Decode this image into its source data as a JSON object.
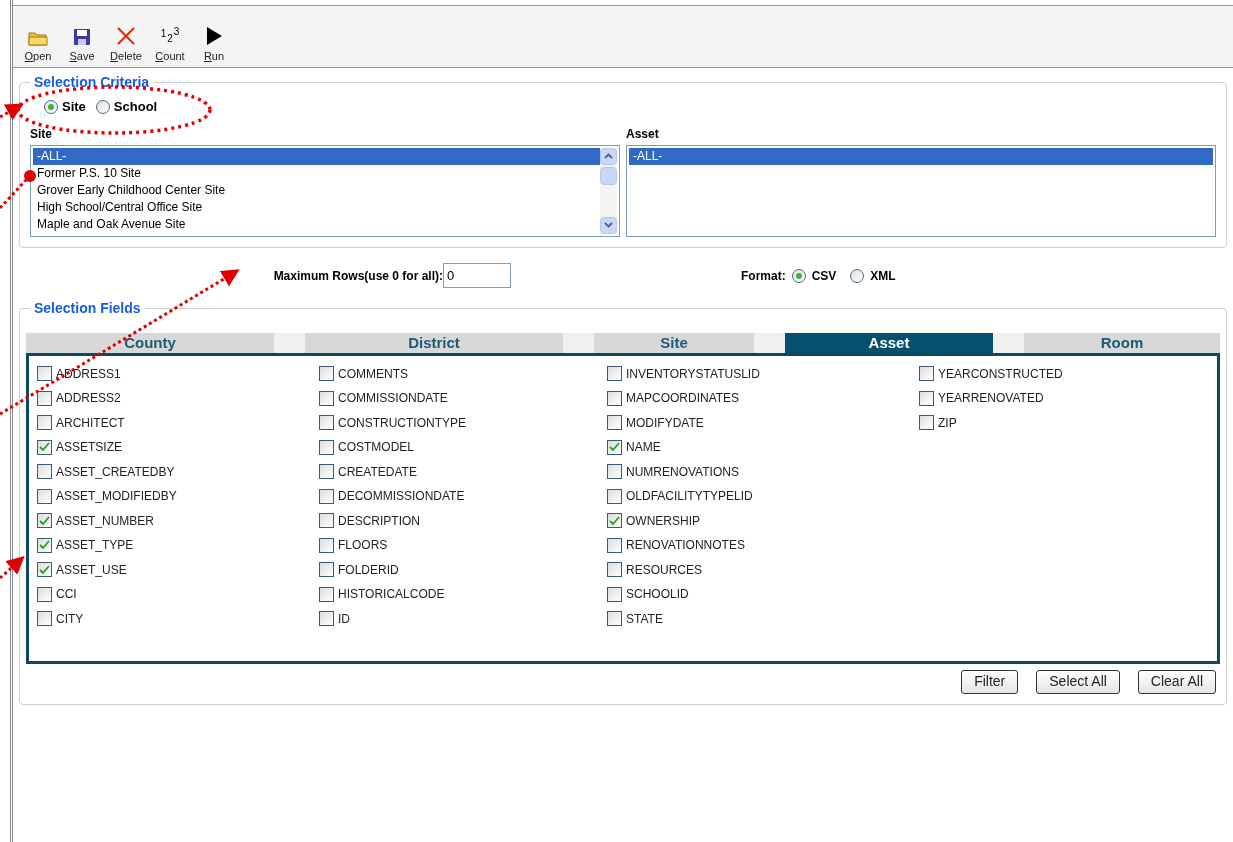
{
  "toolbar": [
    {
      "label": "Open"
    },
    {
      "label": "Save"
    },
    {
      "label": "Delete"
    },
    {
      "label": "Count",
      "glyph": [
        "1",
        "2",
        "3"
      ]
    },
    {
      "label": "Run"
    }
  ],
  "criteria": {
    "title": "Selection Criteria",
    "mode": [
      {
        "label": "Site",
        "selected": true
      },
      {
        "label": "School",
        "selected": false
      }
    ],
    "site_list": {
      "label": "Site",
      "items": [
        {
          "text": "-ALL-",
          "selected": true
        },
        {
          "text": "Former P.S. 10 Site",
          "selected": false
        },
        {
          "text": "Grover Early Childhood Center Site",
          "selected": false
        },
        {
          "text": "High School/Central Office Site",
          "selected": false
        },
        {
          "text": "Maple and Oak Avenue Site",
          "selected": false
        }
      ]
    },
    "asset_list": {
      "label": "Asset",
      "items": [
        {
          "text": "-ALL-",
          "selected": true
        }
      ]
    }
  },
  "max_rows": {
    "label": "Maximum Rows(use 0 for all):",
    "value": "0"
  },
  "format": {
    "label": "Format:",
    "options": [
      {
        "label": "CSV",
        "selected": true
      },
      {
        "label": "XML",
        "selected": false
      }
    ]
  },
  "fields": {
    "title": "Selection Fields",
    "tabs": [
      {
        "label": "County",
        "selected": false
      },
      {
        "label": "District",
        "selected": false
      },
      {
        "label": "Site",
        "selected": false
      },
      {
        "label": "Asset",
        "selected": true
      },
      {
        "label": "Room",
        "selected": false
      }
    ],
    "columns": [
      [
        {
          "label": "ADDRESS1",
          "checked": false
        },
        {
          "label": "ADDRESS2",
          "checked": false
        },
        {
          "label": "ARCHITECT",
          "checked": false
        },
        {
          "label": "ASSETSIZE",
          "checked": true
        },
        {
          "label": "ASSET_CREATEDBY",
          "checked": false
        },
        {
          "label": "ASSET_MODIFIEDBY",
          "checked": false
        },
        {
          "label": "ASSET_NUMBER",
          "checked": true
        },
        {
          "label": "ASSET_TYPE",
          "checked": true
        },
        {
          "label": "ASSET_USE",
          "checked": true
        },
        {
          "label": "CCI",
          "checked": false
        },
        {
          "label": "CITY",
          "checked": false
        }
      ],
      [
        {
          "label": "COMMENTS",
          "checked": false
        },
        {
          "label": "COMMISSIONDATE",
          "checked": false
        },
        {
          "label": "CONSTRUCTIONTYPE",
          "checked": false
        },
        {
          "label": "COSTMODEL",
          "checked": false
        },
        {
          "label": "CREATEDATE",
          "checked": false
        },
        {
          "label": "DECOMMISSIONDATE",
          "checked": false
        },
        {
          "label": "DESCRIPTION",
          "checked": false
        },
        {
          "label": "FLOORS",
          "checked": false
        },
        {
          "label": "FOLDERID",
          "checked": false
        },
        {
          "label": "HISTORICALCODE",
          "checked": false
        },
        {
          "label": "ID",
          "checked": false
        }
      ],
      [
        {
          "label": "INVENTORYSTATUSLID",
          "checked": false
        },
        {
          "label": "MAPCOORDINATES",
          "checked": false
        },
        {
          "label": "MODIFYDATE",
          "checked": false
        },
        {
          "label": "NAME",
          "checked": true
        },
        {
          "label": "NUMRENOVATIONS",
          "checked": false
        },
        {
          "label": "OLDFACILITYTYPELID",
          "checked": false
        },
        {
          "label": "OWNERSHIP",
          "checked": true
        },
        {
          "label": "RENOVATIONNOTES",
          "checked": false
        },
        {
          "label": "RESOURCES",
          "checked": false
        },
        {
          "label": "SCHOOLID",
          "checked": false
        },
        {
          "label": "STATE",
          "checked": false
        }
      ],
      [
        {
          "label": "YEARCONSTRUCTED",
          "checked": false
        },
        {
          "label": "YEARRENOVATED",
          "checked": false
        },
        {
          "label": "ZIP",
          "checked": false
        }
      ]
    ]
  },
  "buttons": [
    "Filter",
    "Select All",
    "Clear All"
  ]
}
